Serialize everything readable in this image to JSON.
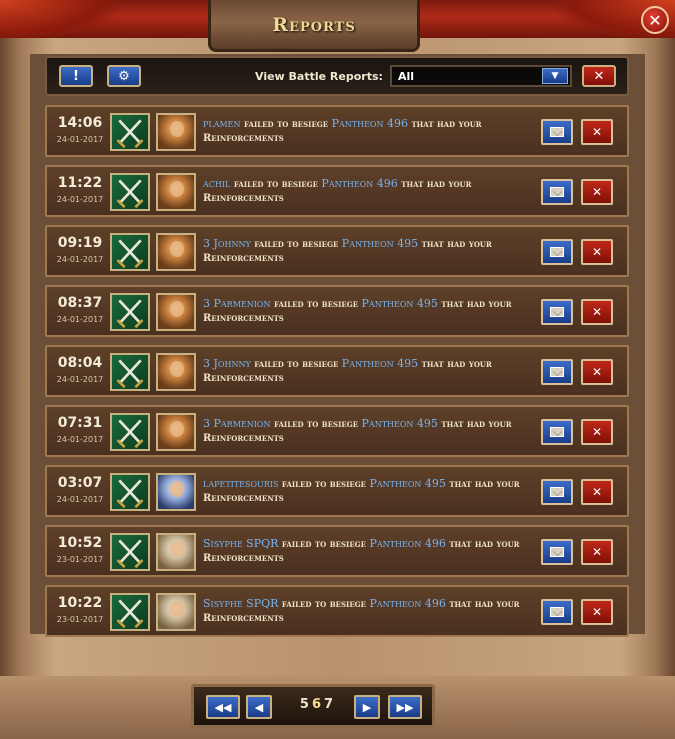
{
  "window": {
    "title": "Reports"
  },
  "toolbar": {
    "alert_label": "!",
    "filter_label": "View Battle Reports:",
    "filter_value": "All",
    "delete_label": "✕"
  },
  "rows": [
    {
      "time": "14:06",
      "date": "24-01-2017",
      "name": "plamen",
      "text1": "failed to besiege",
      "target": "Pantheon 496",
      "text2": "that had your Reinforcements",
      "avatar": "gold"
    },
    {
      "time": "11:22",
      "date": "24-01-2017",
      "name": "achil",
      "text1": "failed to besiege",
      "target": "Pantheon 496",
      "text2": "that had your Reinforcements",
      "avatar": "gold"
    },
    {
      "time": "09:19",
      "date": "24-01-2017",
      "name": "3 Johnny",
      "text1": "failed to besiege",
      "target": "Pantheon 495",
      "text2": "that had your Reinforcements",
      "avatar": "gold"
    },
    {
      "time": "08:37",
      "date": "24-01-2017",
      "name": "3 Parmenion",
      "text1": "failed to besiege",
      "target": "Pantheon 495",
      "text2": "that had your Reinforcements",
      "avatar": "gold"
    },
    {
      "time": "08:04",
      "date": "24-01-2017",
      "name": "3 Johnny",
      "text1": "failed to besiege",
      "target": "Pantheon 495",
      "text2": "that had your Reinforcements",
      "avatar": "gold"
    },
    {
      "time": "07:31",
      "date": "24-01-2017",
      "name": "3 Parmenion",
      "text1": "failed to besiege",
      "target": "Pantheon 495",
      "text2": "that had your Reinforcements",
      "avatar": "gold"
    },
    {
      "time": "03:07",
      "date": "24-01-2017",
      "name": "lapetitesouris",
      "text1": "failed to besiege",
      "target": "Pantheon 495",
      "text2": "that had your Reinforcements",
      "avatar": "blue"
    },
    {
      "time": "10:52",
      "date": "23-01-2017",
      "name": "Sisyphe SPQR",
      "text1": "failed to besiege",
      "target": "Pantheon 496",
      "text2": "that had your Reinforcements",
      "avatar": "pale"
    },
    {
      "time": "10:22",
      "date": "23-01-2017",
      "name": "Sisyphe SPQR",
      "text1": "failed to besiege",
      "target": "Pantheon 496",
      "text2": "that had your Reinforcements",
      "avatar": "pale"
    }
  ],
  "pagination": {
    "prev_page": "5",
    "current_page": "6",
    "next_page": "7"
  },
  "colors": {
    "link_blue": "#78b4f0",
    "button_blue": "#1a3c88",
    "button_red": "#801008",
    "title_gold": "#f0d890"
  }
}
